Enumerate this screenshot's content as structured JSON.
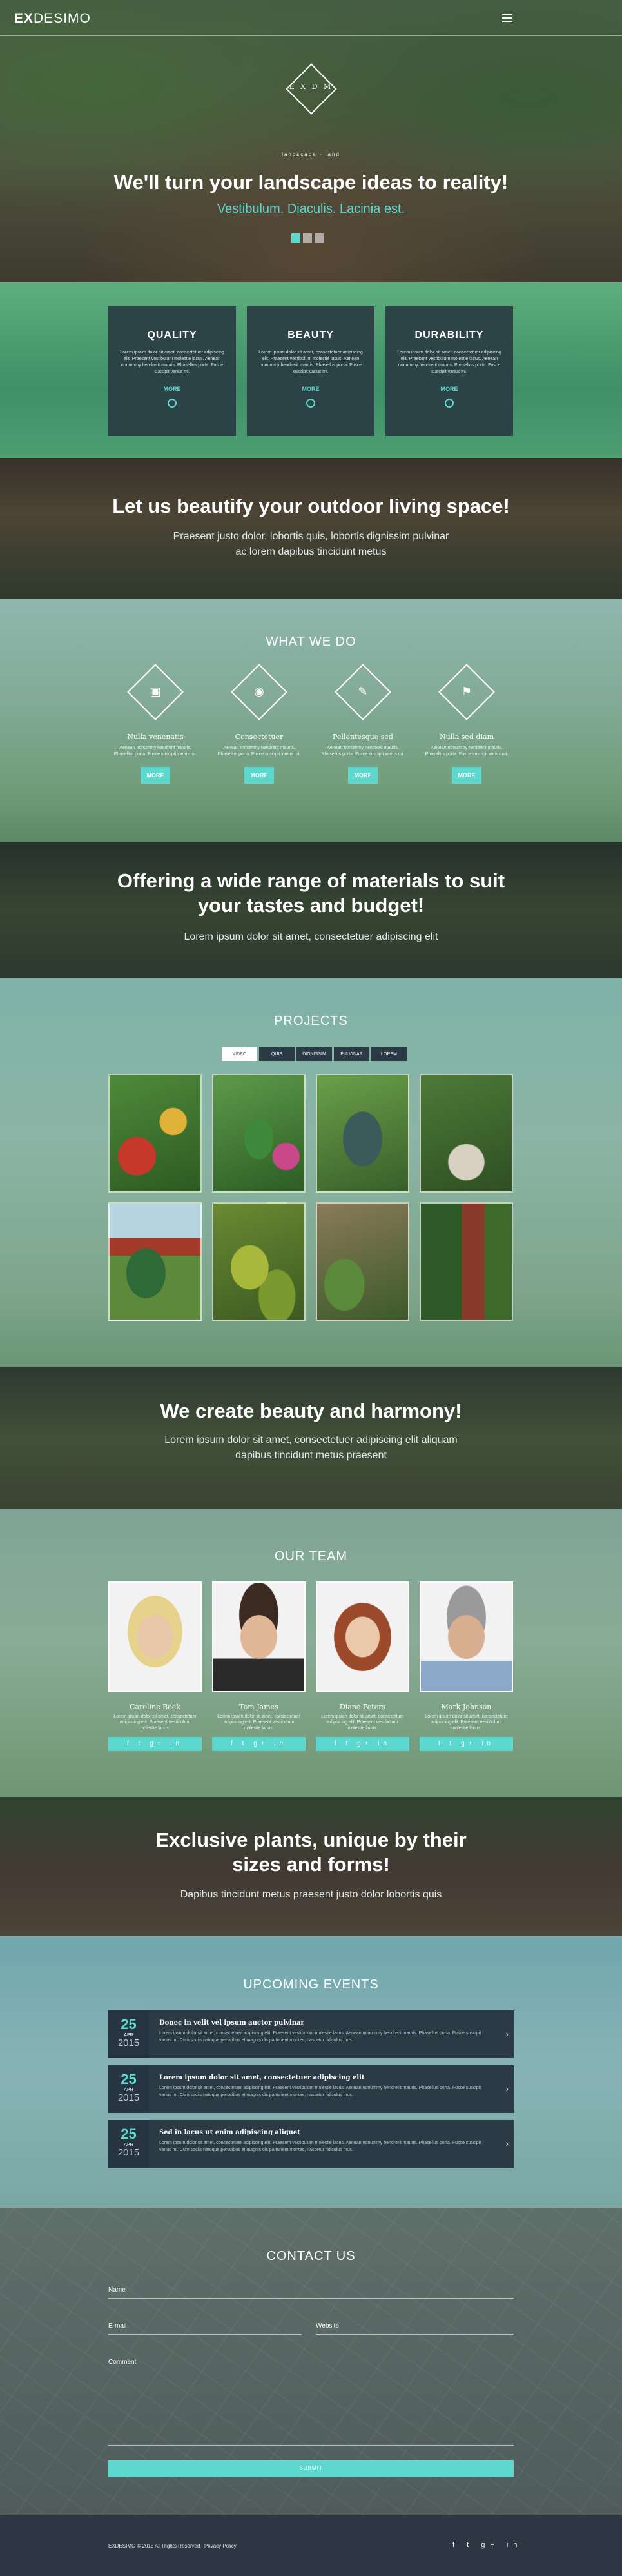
{
  "colors": {
    "accent": "#5dd8cf",
    "dark": "#2b3a44"
  },
  "header": {
    "logo_bold": "EX",
    "logo_light": "DESIMO",
    "menu_icon": "hamburger-icon"
  },
  "hero": {
    "emblem_letters": "E X D M",
    "emblem_caption": "landscape · land",
    "title": "We'll turn your landscape ideas to reality!",
    "subtitle": "Vestibulum. Diaculis. Lacinia est.",
    "slides": 3,
    "active_slide": 1
  },
  "features": [
    {
      "title": "QUALITY",
      "text": "Lorem ipsum dolor sit amet, consectetuer adipiscing elit. Praesent vestibulum molestie lacus. Aenean nonummy hendrerit mauris. Phasellus porta. Fusce suscipit varius mi.",
      "more": "MORE"
    },
    {
      "title": "BEAUTY",
      "text": "Lorem ipsum dolor sit amet, consectetuer adipiscing elit. Praesent vestibulum molestie lacus. Aenean nonummy hendrerit mauris. Phasellus porta. Fusce suscipit varius mi.",
      "more": "MORE"
    },
    {
      "title": "DURABILITY",
      "text": "Lorem ipsum dolor sit amet, consectetuer adipiscing elit. Praesent vestibulum molestie lacus. Aenean nonummy hendrerit mauris. Phasellus porta. Fusce suscipit varius mi.",
      "more": "MORE"
    }
  ],
  "banner1": {
    "title": "Let us beautify your outdoor living space!",
    "line1": "Praesent justo dolor, lobortis quis, lobortis dignissim pulvinar",
    "line2": "ac lorem dapibus tincidunt metus"
  },
  "whatwedo": {
    "title": "WHAT WE DO",
    "items": [
      {
        "name": "Nulla venenatis",
        "icon": "cube-icon",
        "text": "Aenean nonummy hendrerit mauris. Phasellus porta. Fusce suscipit varius mi.",
        "more": "MORE"
      },
      {
        "name": "Consectetuer",
        "icon": "eye-icon",
        "text": "Aenean nonummy hendrerit mauris. Phasellus porta. Fusce suscipit varius mi.",
        "more": "MORE"
      },
      {
        "name": "Pellentesque sed",
        "icon": "edit-icon",
        "text": "Aenean nonummy hendrerit mauris. Phasellus porta. Fusce suscipit varius mi.",
        "more": "MORE"
      },
      {
        "name": "Nulla sed diam",
        "icon": "flag-icon",
        "text": "Aenean nonummy hendrerit mauris. Phasellus porta. Fusce suscipit varius mi.",
        "more": "MORE"
      }
    ]
  },
  "banner2": {
    "title_line1": "Offering a wide range of materials to suit",
    "title_line2": "your tastes and budget!",
    "text": "Lorem ipsum dolor sit amet, consectetuer adipiscing elit"
  },
  "projects": {
    "title": "PROJECTS",
    "filters": [
      "VIDEO",
      "QUIS",
      "DIGNISSIM",
      "PULVINAR",
      "LOREM"
    ],
    "active_filter": 0
  },
  "banner3": {
    "title": "We create beauty and harmony!",
    "line1": "Lorem ipsum dolor sit amet, consectetuer adipiscing elit aliquam",
    "line2": "dapibus tincidunt metus praesent"
  },
  "team": {
    "title": "OUR TEAM",
    "members": [
      {
        "name": "Caroline Beek",
        "text": "Lorem ipsum dolor sit amet, consectetuer adipiscing elit. Praesent vestibulum molestie lacus."
      },
      {
        "name": "Tom James",
        "text": "Lorem ipsum dolor sit amet, consectetuer adipiscing elit. Praesent vestibulum molestie lacus."
      },
      {
        "name": "Diane Peters",
        "text": "Lorem ipsum dolor sit amet, consectetuer adipiscing elit. Praesent vestibulum molestie lacus."
      },
      {
        "name": "Mark Johnson",
        "text": "Lorem ipsum dolor sit amet, consectetuer adipiscing elit. Praesent vestibulum molestie lacus."
      }
    ],
    "social_icons": "f t g+ in"
  },
  "banner4": {
    "title_line1": "Exclusive plants, unique by their",
    "title_line2": "sizes and forms!",
    "text": "Dapibus tincidunt metus praesent justo dolor lobortis quis"
  },
  "events": {
    "title": "UPCOMING EVENTS",
    "items": [
      {
        "day": "25",
        "month": "APR",
        "year": "2015",
        "title": "Donec in velit vel ipsum auctor pulvinar",
        "text": "Lorem ipsum dolor sit amet, consectetuer adipiscing elit. Praesent vestibulum molestie lacus. Aenean nonummy hendrerit mauris. Phasellus porta. Fusce suscipit varius mi. Cum sociis natoque penatibus et magnis dis parturient montes, nascetur ridiculus mus."
      },
      {
        "day": "25",
        "month": "APR",
        "year": "2015",
        "title": "Lorem ipsum dolor sit amet, consectetuer adipiscing elit",
        "text": "Lorem ipsum dolor sit amet, consectetuer adipiscing elit. Praesent vestibulum molestie lacus. Aenean nonummy hendrerit mauris. Phasellus porta. Fusce suscipit varius mi. Cum sociis natoque penatibus et magnis dis parturient montes, nascetur ridiculus mus."
      },
      {
        "day": "25",
        "month": "APR",
        "year": "2015",
        "title": "Sed in lacus ut enim adipiscing aliquet",
        "text": "Lorem ipsum dolor sit amet, consectetuer adipiscing elit. Praesent vestibulum molestie lacus. Aenean nonummy hendrerit mauris. Phasellus porta. Fusce suscipit varius mi. Cum sociis natoque penatibus et magnis dis parturient montes, nascetur ridiculus mus."
      }
    ]
  },
  "contact": {
    "title": "CONTACT US",
    "name_label": "Name",
    "email_label": "E-mail",
    "website_label": "Website",
    "comment_label": "Comment",
    "submit": "SUBMIT"
  },
  "footer": {
    "copyright": "EXDESIMO © 2015 All Rights Reserved | Privacy Policy",
    "icons": "f t g+ in"
  }
}
